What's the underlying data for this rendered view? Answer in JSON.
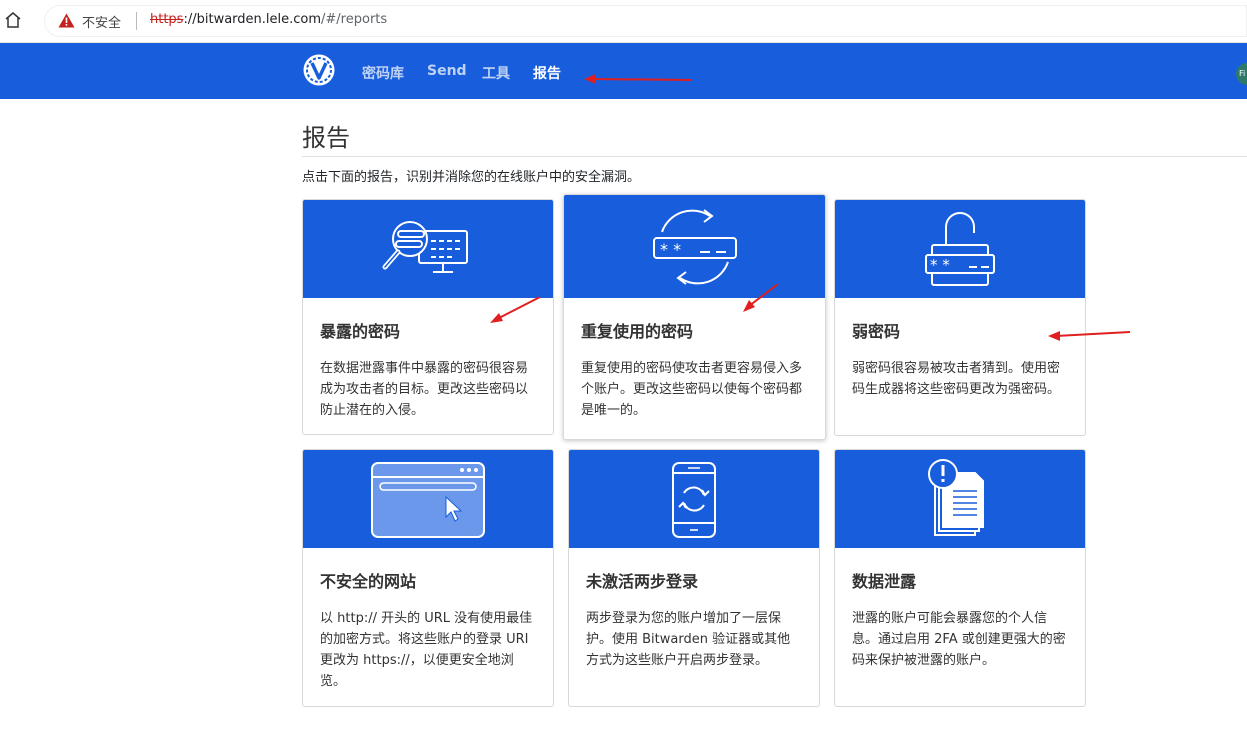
{
  "browser": {
    "insecure_label": "不安全",
    "url_scheme": "https",
    "url_host": "://bitwarden.lele.com",
    "url_path": "/#/reports"
  },
  "nav": {
    "items": [
      {
        "label": "密码库"
      },
      {
        "label": "Send"
      },
      {
        "label": "工具"
      },
      {
        "label": "报告",
        "active": true
      }
    ],
    "avatar_text": "Fi"
  },
  "page": {
    "title": "报告",
    "description": "点击下面的报告，识别并消除您的在线账户中的安全漏洞。"
  },
  "cards": [
    {
      "title": "暴露的密码",
      "text": "在数据泄露事件中暴露的密码很容易成为攻击者的目标。更改这些密码以防止潜在的入侵。",
      "icon": "magnifier-monitor-icon"
    },
    {
      "title": "重复使用的密码",
      "text": "重复使用的密码使攻击者更容易侵入多个账户。更改这些密码以使每个密码都是唯一的。",
      "icon": "reuse-password-icon"
    },
    {
      "title": "弱密码",
      "text": "弱密码很容易被攻击者猜到。使用密码生成器将这些密码更改为强密码。",
      "icon": "padlock-icon"
    },
    {
      "title": "不安全的网站",
      "text": "以 http:// 开头的 URL 没有使用最佳的加密方式。将这些账户的登录 URI 更改为 https://，以便更安全地浏览。",
      "icon": "browser-window-icon"
    },
    {
      "title": "未激活两步登录",
      "text": "两步登录为您的账户增加了一层保护。使用 Bitwarden 验证器或其他方式为这些账户开启两步登录。",
      "icon": "phone-sync-icon"
    },
    {
      "title": "数据泄露",
      "text": "泄露的账户可能会暴露您的个人信息。通过启用 2FA 或创建更强大的密码来保护被泄露的账户。",
      "icon": "document-alert-icon"
    }
  ],
  "colors": {
    "brand": "#175ddc",
    "annotation": "#e02020"
  }
}
